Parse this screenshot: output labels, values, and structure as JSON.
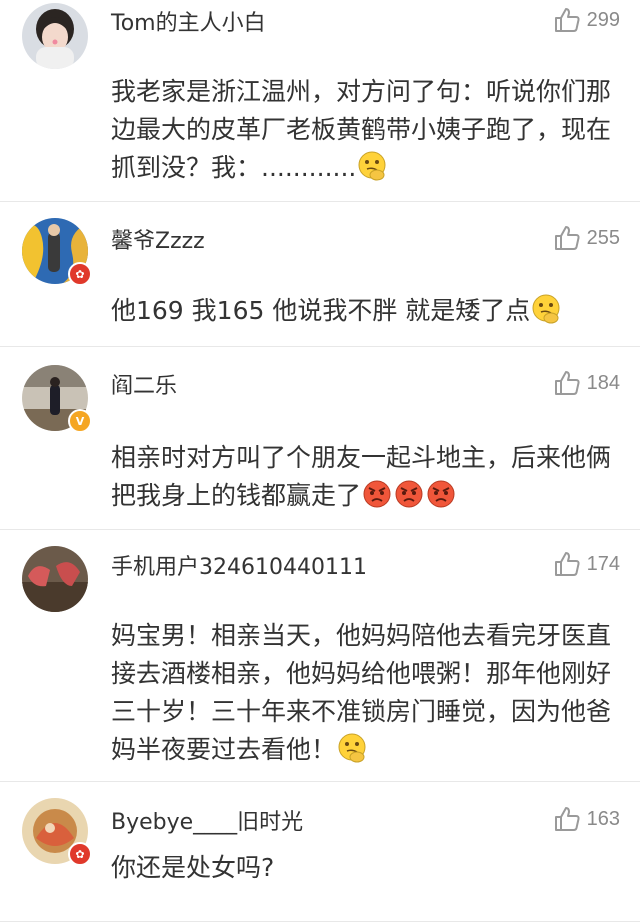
{
  "comments": [
    {
      "username": "Tom的主人小白",
      "likes": "299",
      "text": "我老家是浙江温州，对方问了句：听说你们那边最大的皮革厂老板黄鹤带小姨子跑了，现在抓到没？我：............",
      "emojis": [
        "thinking-emoji"
      ],
      "badge": ""
    },
    {
      "username": "馨爷Zzzz",
      "likes": "255",
      "text": "他169 我165 他说我不胖 就是矮了点",
      "emojis": [
        "thinking-emoji"
      ],
      "badge": "red"
    },
    {
      "username": "阎二乐",
      "likes": "184",
      "text": "相亲时对方叫了个朋友一起斗地主，后来他俩把我身上的钱都赢走了",
      "emojis": [
        "angry-emoji",
        "angry-emoji",
        "angry-emoji"
      ],
      "badge": "gold"
    },
    {
      "username": "手机用户324610440111",
      "likes": "174",
      "text": "妈宝男！相亲当天，他妈妈陪他去看完牙医直接去酒楼相亲，他妈妈给他喂粥！那年他刚好三十岁！三十年来不准锁房门睡觉，因为他爸妈半夜要过去看他！",
      "emojis": [
        "thinking-emoji"
      ],
      "badge": ""
    },
    {
      "username": "Byebye____旧时光",
      "likes": "163",
      "text": "你还是处女吗?",
      "emojis": [],
      "badge": "red"
    }
  ],
  "icons": {
    "like": "thumbs-up-icon",
    "badge_red": "weibo-badge-icon",
    "badge_gold": "verified-v-icon"
  },
  "colors": {
    "text": "#333333",
    "count": "#8a8a8a",
    "divider": "#e8e8e8",
    "badge_red": "#e0392b",
    "badge_gold": "#f5a623"
  }
}
